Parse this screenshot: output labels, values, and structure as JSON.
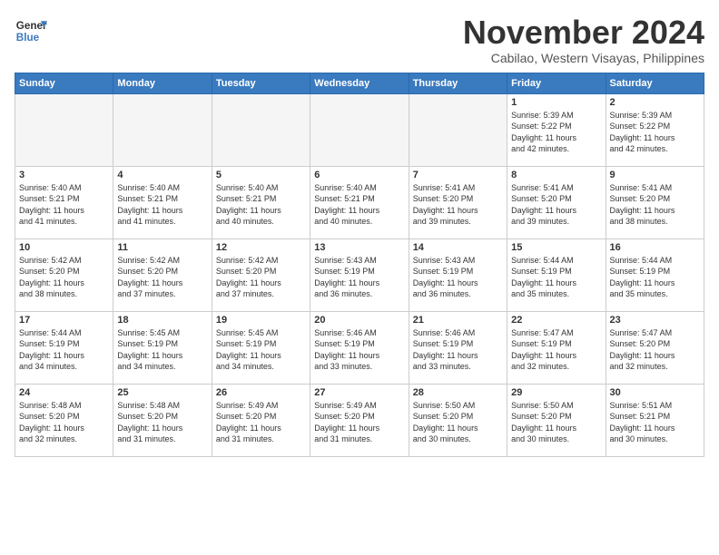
{
  "header": {
    "logo_line1": "General",
    "logo_line2": "Blue",
    "month": "November 2024",
    "location": "Cabilao, Western Visayas, Philippines"
  },
  "weekdays": [
    "Sunday",
    "Monday",
    "Tuesday",
    "Wednesday",
    "Thursday",
    "Friday",
    "Saturday"
  ],
  "weeks": [
    [
      {
        "day": "",
        "info": ""
      },
      {
        "day": "",
        "info": ""
      },
      {
        "day": "",
        "info": ""
      },
      {
        "day": "",
        "info": ""
      },
      {
        "day": "",
        "info": ""
      },
      {
        "day": "1",
        "info": "Sunrise: 5:39 AM\nSunset: 5:22 PM\nDaylight: 11 hours\nand 42 minutes."
      },
      {
        "day": "2",
        "info": "Sunrise: 5:39 AM\nSunset: 5:22 PM\nDaylight: 11 hours\nand 42 minutes."
      }
    ],
    [
      {
        "day": "3",
        "info": "Sunrise: 5:40 AM\nSunset: 5:21 PM\nDaylight: 11 hours\nand 41 minutes."
      },
      {
        "day": "4",
        "info": "Sunrise: 5:40 AM\nSunset: 5:21 PM\nDaylight: 11 hours\nand 41 minutes."
      },
      {
        "day": "5",
        "info": "Sunrise: 5:40 AM\nSunset: 5:21 PM\nDaylight: 11 hours\nand 40 minutes."
      },
      {
        "day": "6",
        "info": "Sunrise: 5:40 AM\nSunset: 5:21 PM\nDaylight: 11 hours\nand 40 minutes."
      },
      {
        "day": "7",
        "info": "Sunrise: 5:41 AM\nSunset: 5:20 PM\nDaylight: 11 hours\nand 39 minutes."
      },
      {
        "day": "8",
        "info": "Sunrise: 5:41 AM\nSunset: 5:20 PM\nDaylight: 11 hours\nand 39 minutes."
      },
      {
        "day": "9",
        "info": "Sunrise: 5:41 AM\nSunset: 5:20 PM\nDaylight: 11 hours\nand 38 minutes."
      }
    ],
    [
      {
        "day": "10",
        "info": "Sunrise: 5:42 AM\nSunset: 5:20 PM\nDaylight: 11 hours\nand 38 minutes."
      },
      {
        "day": "11",
        "info": "Sunrise: 5:42 AM\nSunset: 5:20 PM\nDaylight: 11 hours\nand 37 minutes."
      },
      {
        "day": "12",
        "info": "Sunrise: 5:42 AM\nSunset: 5:20 PM\nDaylight: 11 hours\nand 37 minutes."
      },
      {
        "day": "13",
        "info": "Sunrise: 5:43 AM\nSunset: 5:19 PM\nDaylight: 11 hours\nand 36 minutes."
      },
      {
        "day": "14",
        "info": "Sunrise: 5:43 AM\nSunset: 5:19 PM\nDaylight: 11 hours\nand 36 minutes."
      },
      {
        "day": "15",
        "info": "Sunrise: 5:44 AM\nSunset: 5:19 PM\nDaylight: 11 hours\nand 35 minutes."
      },
      {
        "day": "16",
        "info": "Sunrise: 5:44 AM\nSunset: 5:19 PM\nDaylight: 11 hours\nand 35 minutes."
      }
    ],
    [
      {
        "day": "17",
        "info": "Sunrise: 5:44 AM\nSunset: 5:19 PM\nDaylight: 11 hours\nand 34 minutes."
      },
      {
        "day": "18",
        "info": "Sunrise: 5:45 AM\nSunset: 5:19 PM\nDaylight: 11 hours\nand 34 minutes."
      },
      {
        "day": "19",
        "info": "Sunrise: 5:45 AM\nSunset: 5:19 PM\nDaylight: 11 hours\nand 34 minutes."
      },
      {
        "day": "20",
        "info": "Sunrise: 5:46 AM\nSunset: 5:19 PM\nDaylight: 11 hours\nand 33 minutes."
      },
      {
        "day": "21",
        "info": "Sunrise: 5:46 AM\nSunset: 5:19 PM\nDaylight: 11 hours\nand 33 minutes."
      },
      {
        "day": "22",
        "info": "Sunrise: 5:47 AM\nSunset: 5:19 PM\nDaylight: 11 hours\nand 32 minutes."
      },
      {
        "day": "23",
        "info": "Sunrise: 5:47 AM\nSunset: 5:20 PM\nDaylight: 11 hours\nand 32 minutes."
      }
    ],
    [
      {
        "day": "24",
        "info": "Sunrise: 5:48 AM\nSunset: 5:20 PM\nDaylight: 11 hours\nand 32 minutes."
      },
      {
        "day": "25",
        "info": "Sunrise: 5:48 AM\nSunset: 5:20 PM\nDaylight: 11 hours\nand 31 minutes."
      },
      {
        "day": "26",
        "info": "Sunrise: 5:49 AM\nSunset: 5:20 PM\nDaylight: 11 hours\nand 31 minutes."
      },
      {
        "day": "27",
        "info": "Sunrise: 5:49 AM\nSunset: 5:20 PM\nDaylight: 11 hours\nand 31 minutes."
      },
      {
        "day": "28",
        "info": "Sunrise: 5:50 AM\nSunset: 5:20 PM\nDaylight: 11 hours\nand 30 minutes."
      },
      {
        "day": "29",
        "info": "Sunrise: 5:50 AM\nSunset: 5:20 PM\nDaylight: 11 hours\nand 30 minutes."
      },
      {
        "day": "30",
        "info": "Sunrise: 5:51 AM\nSunset: 5:21 PM\nDaylight: 11 hours\nand 30 minutes."
      }
    ]
  ]
}
